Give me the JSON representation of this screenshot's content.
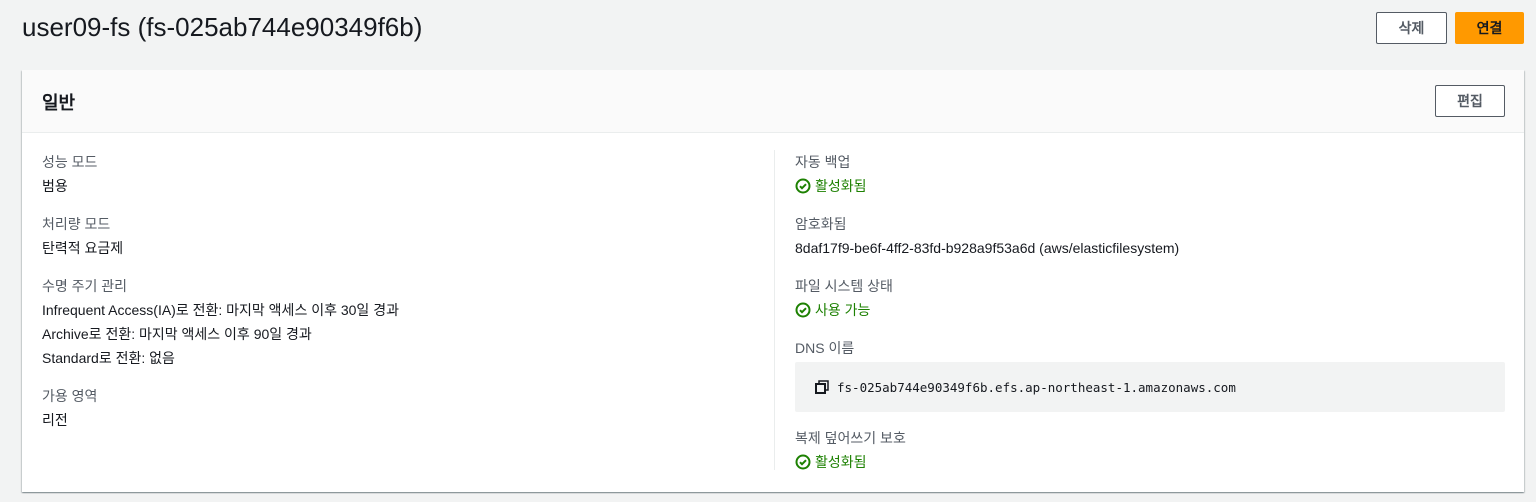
{
  "header": {
    "title": "user09-fs (fs-025ab744e90349f6b)",
    "delete_label": "삭제",
    "connect_label": "연결"
  },
  "card": {
    "title": "일반",
    "edit_label": "편집"
  },
  "left": [
    {
      "label": "성능 모드",
      "values": [
        "범용"
      ]
    },
    {
      "label": "처리량 모드",
      "values": [
        "탄력적 요금제"
      ]
    },
    {
      "label": "수명 주기 관리",
      "values": [
        "Infrequent Access(IA)로 전환: 마지막 액세스 이후 30일 경과",
        "Archive로 전환: 마지막 액세스 이후 90일 경과",
        "Standard로 전환: 없음"
      ]
    },
    {
      "label": "가용 영역",
      "values": [
        "리전"
      ]
    }
  ],
  "right": {
    "backup": {
      "label": "자동 백업",
      "value": "활성화됨",
      "icon": "check-circle-icon"
    },
    "encrypted": {
      "label": "암호화됨",
      "value": "8daf17f9-be6f-4ff2-83fd-b928a9f53a6d (aws/elasticfilesystem)"
    },
    "state": {
      "label": "파일 시스템 상태",
      "value": "사용 가능",
      "icon": "check-circle-icon"
    },
    "dns": {
      "label": "DNS 이름",
      "value": "fs-025ab744e90349f6b.efs.ap-northeast-1.amazonaws.com",
      "icon": "copy-icon"
    },
    "replication": {
      "label": "복제 덮어쓰기 보호",
      "value": "활성화됨",
      "icon": "check-circle-icon"
    }
  },
  "colors": {
    "accent": "#ff9900",
    "success": "#1d8102"
  }
}
